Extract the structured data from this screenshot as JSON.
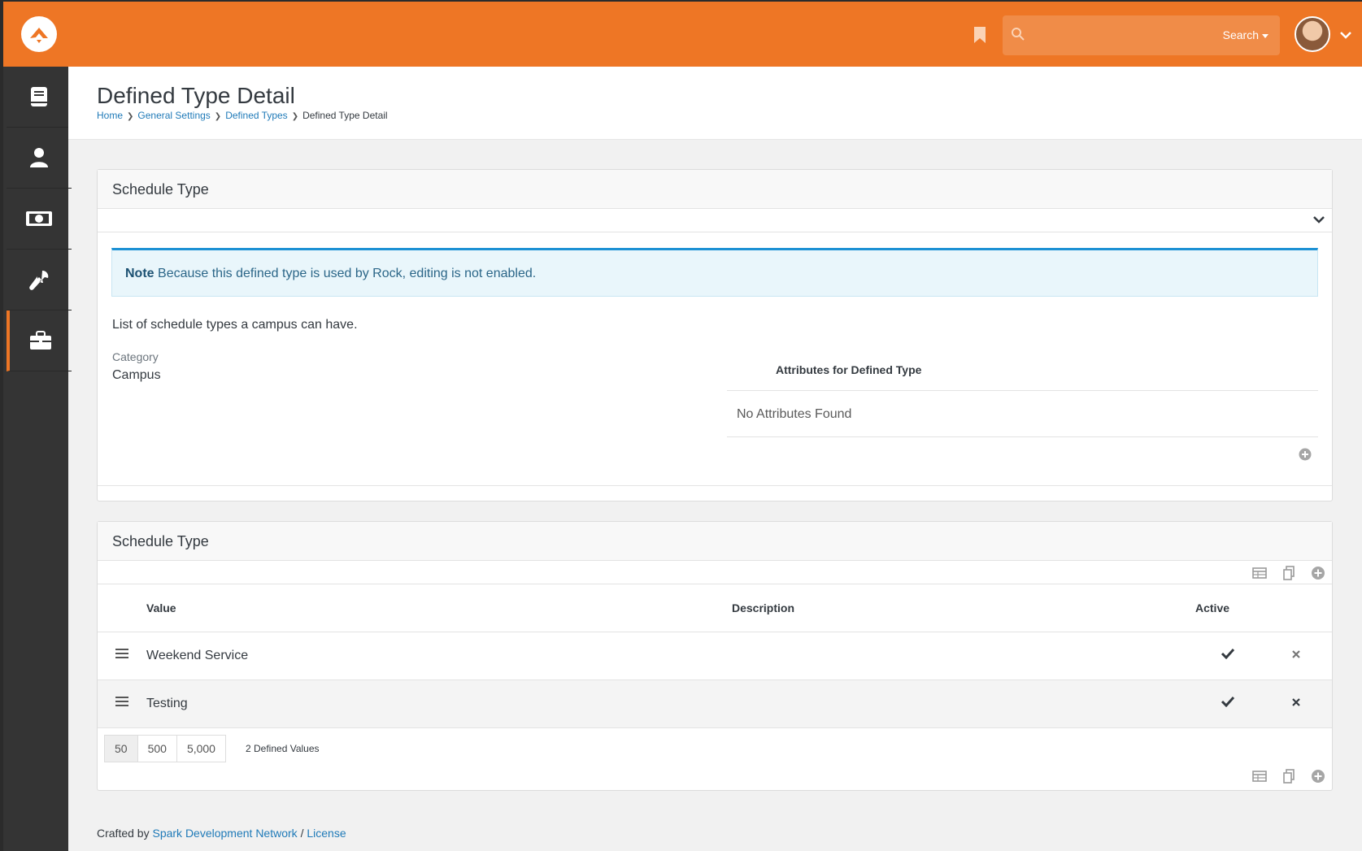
{
  "header": {
    "search_label": "Search",
    "icons": {
      "logo": "rock-logo-icon",
      "bookmark": "bookmark-icon",
      "search": "search-icon",
      "user": "avatar",
      "menu": "chevron-down-icon"
    },
    "accent": "#ee7625"
  },
  "sidebar": {
    "items": [
      {
        "icon": "book-icon",
        "label": ""
      },
      {
        "icon": "person-icon",
        "label": ""
      },
      {
        "icon": "money-icon",
        "label": ""
      },
      {
        "icon": "wrench-icon",
        "label": ""
      },
      {
        "icon": "briefcase-icon",
        "label": ""
      }
    ],
    "active_index": 4
  },
  "page": {
    "title": "Defined Type Detail",
    "breadcrumbs": [
      "Home",
      "General Settings",
      "Defined Types",
      "Defined Type Detail"
    ]
  },
  "detail": {
    "heading": "Schedule Type",
    "alert_strong": "Note",
    "alert_text": "Because this defined type is used by Rock, editing is not enabled.",
    "description": "List of schedule types a campus can have.",
    "category_label": "Category",
    "category_value": "Campus",
    "attributes_heading": "Attributes for Defined Type",
    "attributes_empty": "No Attributes Found"
  },
  "values_grid": {
    "heading": "Schedule Type",
    "columns": [
      "Value",
      "Description",
      "Active"
    ],
    "rows": [
      {
        "value": "Weekend Service",
        "description": "",
        "active": true
      },
      {
        "value": "Testing",
        "description": "",
        "active": true
      }
    ],
    "page_sizes": [
      "50",
      "500",
      "5,000"
    ],
    "selected_page_size": "50",
    "count_label": "2 Defined Values"
  },
  "footer": {
    "prefix": "Crafted by",
    "link1": "Spark Development Network",
    "sep": "/",
    "link2": "License"
  }
}
